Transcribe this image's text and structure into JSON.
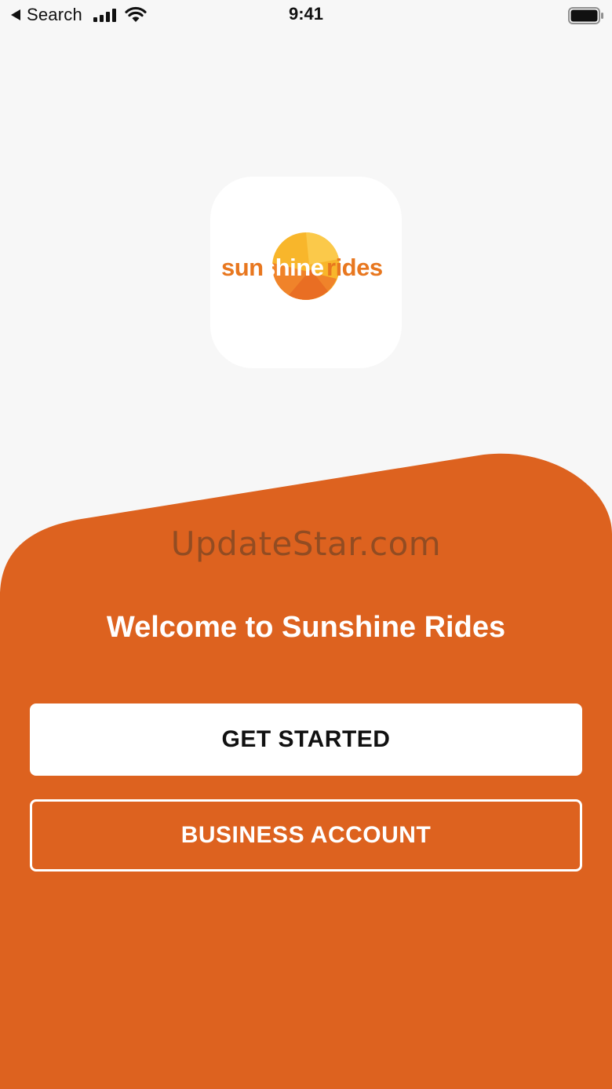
{
  "status_bar": {
    "back_label": "Search",
    "time": "9:41"
  },
  "logo": {
    "wordmark_left": "sun",
    "wordmark_mid": "shine",
    "wordmark_right": "rides",
    "sun_icon": "sun-circle-icon"
  },
  "watermark": "UpdateStar.com",
  "welcome_title": "Welcome to Sunshine Rides",
  "buttons": {
    "get_started": "GET STARTED",
    "business_account": "BUSINESS ACCOUNT"
  },
  "colors": {
    "brand_orange": "#DD621F",
    "sun_yellow": "#F8B62B",
    "sun_orange": "#F0832A",
    "background": "#F7F7F7",
    "button_primary_bg": "#FFFFFF"
  }
}
